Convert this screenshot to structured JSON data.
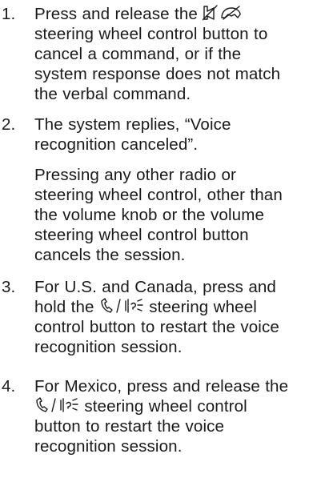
{
  "steps": [
    {
      "num": "1.",
      "text_a": "Press and release the",
      "icon": "hang-up-call-icon",
      "text_b": "steering wheel control button to cancel a command, or if the system response does not match the verbal command."
    },
    {
      "num": "2.",
      "text": "The system replies, “Voice recognition canceled”.",
      "note": "Pressing any other radio or steering wheel control, other than the volume knob or the volume steering wheel control button cancels the session."
    },
    {
      "num": "3.",
      "text_a": "For U.S. and Canada, press and hold the",
      "icon": "push-to-talk-voice-icon",
      "text_b": "steering wheel control button to restart the voice recognition session."
    },
    {
      "num": "4.",
      "text_a": "For Mexico, press and release the",
      "icon": "push-to-talk-voice-icon",
      "text_b": "steering wheel control button to restart the voice recognition session."
    }
  ]
}
